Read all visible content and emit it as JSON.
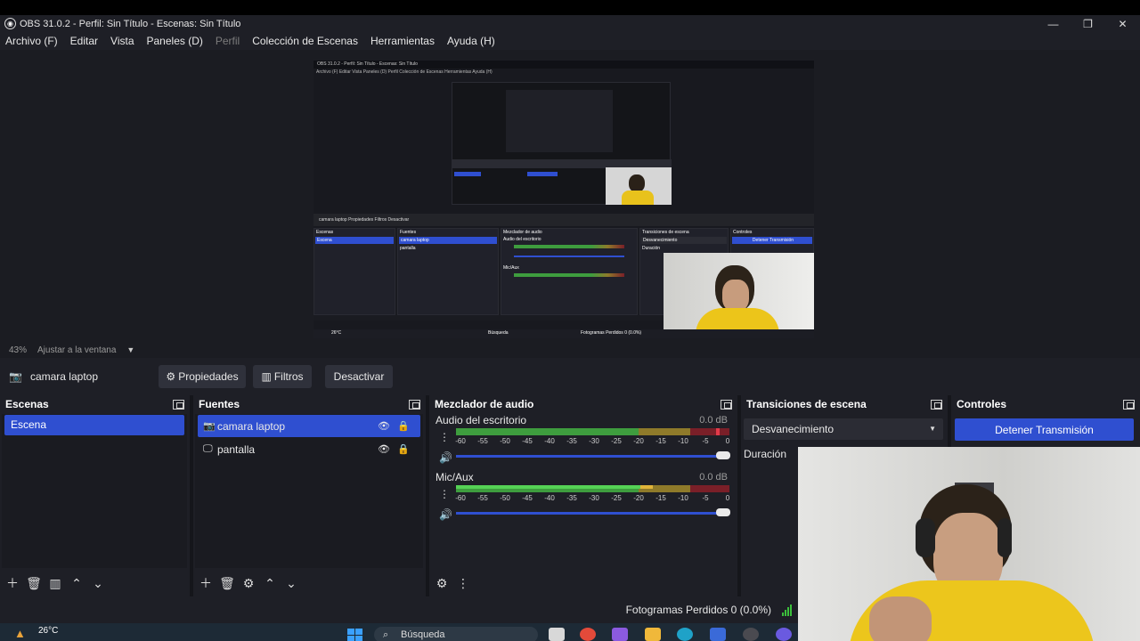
{
  "window": {
    "title": "OBS 31.0.2 - Perfil: Sin Título - Escenas: Sin Título",
    "minimize_glyph": "—",
    "maximize_glyph": "❐",
    "close_glyph": "✕"
  },
  "menu": [
    {
      "label": "Archivo (F)",
      "disabled": false
    },
    {
      "label": "Editar",
      "disabled": false
    },
    {
      "label": "Vista",
      "disabled": false
    },
    {
      "label": "Paneles (D)",
      "disabled": false
    },
    {
      "label": "Perfil",
      "disabled": true
    },
    {
      "label": "Colección de Escenas",
      "disabled": false
    },
    {
      "label": "Herramientas",
      "disabled": false
    },
    {
      "label": "Ayuda (H)",
      "disabled": false
    }
  ],
  "preview": {
    "nested_title": "OBS 31.0.2 - Perfil: Sin Título - Escenas: Sin Título",
    "nested_menu": "Archivo (F)   Editar   Vista   Paneles (D)   Perfil   Colección de Escenas   Herramientas   Ayuda (H)",
    "nested_toolbar": "camara laptop      Propiedades   Filtros   Desactivar",
    "nested_docks": {
      "escenas": "Escenas",
      "escena": "Escena",
      "fuentes": "Fuentes",
      "camara": "camara laptop",
      "pantalla": "pantalla",
      "mezclador": "Mezclador de audio",
      "audio": "Audio del escritorio",
      "mic": "Mic/Aux",
      "transiciones": "Transiciones de escena",
      "desvanecimiento": "Desvanecimiento",
      "duracion": "Duración",
      "controles": "Controles",
      "detener": "Detener Transmisión",
      "fotogramas": "Fotogramas Perdidos 0 (0.0%)",
      "temp": "26°C",
      "busqueda": "Búsqueda"
    }
  },
  "zoom": {
    "percent": "43%",
    "fit_label": "Ajustar a la ventana",
    "caret": "▼"
  },
  "source_toolbar": {
    "source_name": "camara laptop",
    "properties": "Propiedades",
    "filters": "Filtros",
    "deactivate": "Desactivar"
  },
  "scenes": {
    "header": "Escenas",
    "items": [
      "Escena"
    ]
  },
  "sources": {
    "header": "Fuentes",
    "items": [
      {
        "label": "camara laptop",
        "selected": true,
        "icon": "camera-icon"
      },
      {
        "label": "pantalla",
        "selected": false,
        "icon": "monitor-icon"
      }
    ]
  },
  "mixer": {
    "header": "Mezclador de audio",
    "ticks": [
      "-60",
      "-55",
      "-50",
      "-45",
      "-40",
      "-35",
      "-30",
      "-25",
      "-20",
      "-15",
      "-10",
      "-5",
      "0"
    ],
    "channels": [
      {
        "name": "Audio del escritorio",
        "db": "0.0 dB",
        "volume": 1.0
      },
      {
        "name": "Mic/Aux",
        "db": "0.0 dB",
        "volume": 1.0
      }
    ]
  },
  "transitions": {
    "header": "Transiciones de escena",
    "selected": "Desvanecimiento",
    "duration_label": "Duración"
  },
  "controls": {
    "header": "Controles",
    "stop_stream": "Detener Transmisión"
  },
  "status": {
    "dropped_frames": "Fotogramas Perdidos 0 (0.0%)"
  },
  "taskbar": {
    "temperature": "26°C",
    "search": "Búsqueda"
  },
  "colors": {
    "accent": "#2f4fd0",
    "panel": "#1e1f26",
    "meter_green": "#3e9d3e",
    "meter_yellow": "#8f7a2a",
    "meter_red": "#7a1f28",
    "shirt": "#ecc61c"
  }
}
